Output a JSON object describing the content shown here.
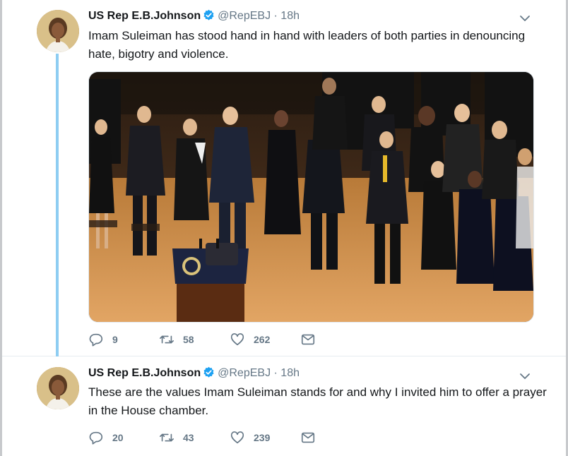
{
  "tweets": [
    {
      "name": "US Rep E.B.Johnson",
      "handle": "@RepEBJ",
      "separator": "·",
      "time": "18h",
      "text": "Imam Suleiman has stood hand in hand with leaders of both parties in denouncing hate, bigotry and violence.",
      "replies": "9",
      "retweets": "58",
      "likes": "262"
    },
    {
      "name": "US Rep E.B.Johnson",
      "handle": "@RepEBJ",
      "separator": "·",
      "time": "18h",
      "text": "These are the values Imam Suleiman stands for and why I invited him to offer a prayer in the House chamber.",
      "replies": "20",
      "retweets": "43",
      "likes": "239"
    }
  ],
  "icons": {
    "verified": "verified-badge-icon",
    "chevron": "chevron-down-icon",
    "reply": "reply-icon",
    "retweet": "retweet-icon",
    "like": "heart-icon",
    "message": "envelope-icon"
  },
  "colors": {
    "accent": "#1da1f2",
    "thread_line": "#8ecdf2",
    "secondary_text": "#657786"
  }
}
